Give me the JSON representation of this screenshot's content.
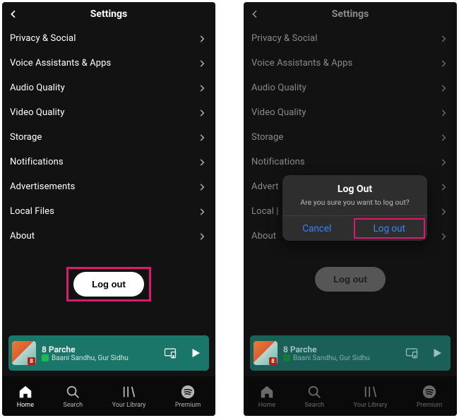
{
  "header": {
    "title": "Settings"
  },
  "items": [
    {
      "label": "Privacy & Social"
    },
    {
      "label": "Voice Assistants & Apps"
    },
    {
      "label": "Audio Quality"
    },
    {
      "label": "Video Quality"
    },
    {
      "label": "Storage"
    },
    {
      "label": "Notifications"
    },
    {
      "label": "Advertisements"
    },
    {
      "label": "Local Files"
    },
    {
      "label": "About"
    }
  ],
  "itemsB": [
    {
      "label": "Privacy & Social"
    },
    {
      "label": "Voice Assistants & Apps"
    },
    {
      "label": "Audio Quality"
    },
    {
      "label": "Video Quality"
    },
    {
      "label": "Storage"
    },
    {
      "label": "Notifications"
    },
    {
      "label": "Advert"
    },
    {
      "label": "Local |"
    },
    {
      "label": "About"
    }
  ],
  "logout_label": "Log out",
  "now_playing": {
    "track": "8 Parche",
    "artist": "Baani Sandhu, Gur Sidhu"
  },
  "nav": {
    "home": "Home",
    "search": "Search",
    "library": "Your Library",
    "premium": "Premium"
  },
  "dialog": {
    "title": "Log Out",
    "message": "Are you sure you want to log out?",
    "cancel": "Cancel",
    "confirm": "Log out"
  },
  "colors": {
    "highlight": "#d81b71",
    "spotify_green": "#1db954",
    "link_blue": "#3a82f7"
  }
}
